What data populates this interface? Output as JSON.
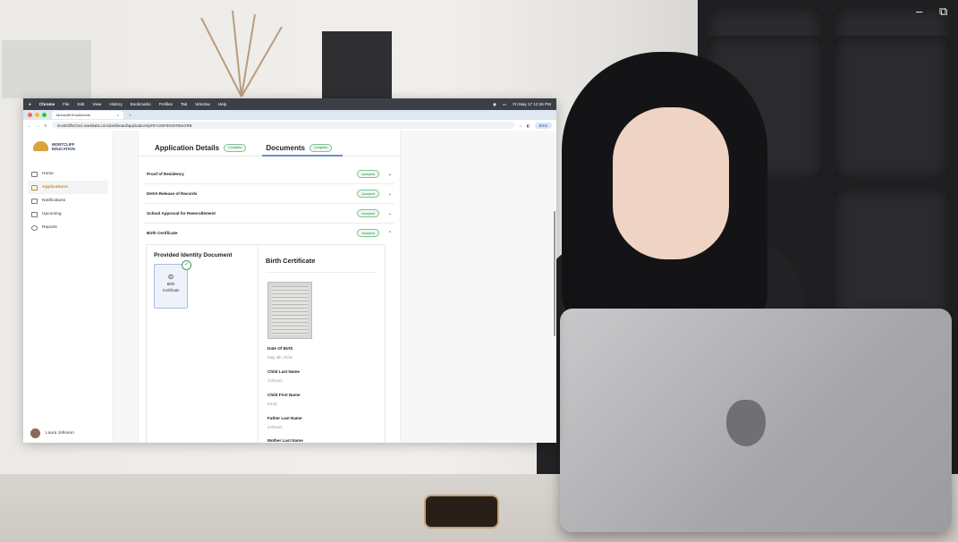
{
  "video": {
    "minimize": "–",
    "close": "⧉"
  },
  "menubar": {
    "apple": "",
    "items": [
      "Chrome",
      "File",
      "Edit",
      "View",
      "History",
      "Bookmarks",
      "Profiles",
      "Tab",
      "Window",
      "Help"
    ],
    "status": "Fri May 17 12:26 PM"
  },
  "browser": {
    "tab_title": "Monticliff Enrollments",
    "tab_close": "×",
    "new_tab": "+",
    "url": "monticliffschool.markitabs.com/dashboard/applications/pFEY1WPdXGKRDeGRB",
    "error_label": "Error"
  },
  "brand": {
    "line1": "MONTCLIFF",
    "line2": "EDUCATION"
  },
  "nav": [
    {
      "label": "Home"
    },
    {
      "label": "Applications"
    },
    {
      "label": "Notifications"
    },
    {
      "label": "Upcoming"
    },
    {
      "label": "Reports"
    }
  ],
  "user": {
    "name": "Laura Johnson"
  },
  "page_tabs": [
    {
      "label": "Application Details",
      "status": "Complete"
    },
    {
      "label": "Documents",
      "status": "Complete"
    }
  ],
  "documents": [
    {
      "name": "Proof of Residency",
      "status": "Accepted",
      "chevron": "⌄"
    },
    {
      "name": "DHVA Release of Records",
      "status": "Accepted",
      "chevron": "⌄"
    },
    {
      "name": "School Approval for Reenrollement",
      "status": "Accepted",
      "chevron": "⌄"
    },
    {
      "name": "Birth Certificate",
      "status": "Accepted",
      "chevron": "⌃"
    }
  ],
  "detail": {
    "left_title": "Provided Identity Document",
    "card_label_1": "Birth",
    "card_label_2": "Certificate",
    "check": "✓",
    "right_title": "Birth Certificate",
    "fields": [
      {
        "label": "Date Of Birth",
        "value": "May 4th, 2016"
      },
      {
        "label": "Child Last Name",
        "value": "Johnson"
      },
      {
        "label": "Child First Name",
        "value": "Emily"
      },
      {
        "label": "Father Last Name",
        "value": "Johnson"
      },
      {
        "label": "Mother Last Name",
        "value": ""
      }
    ]
  }
}
